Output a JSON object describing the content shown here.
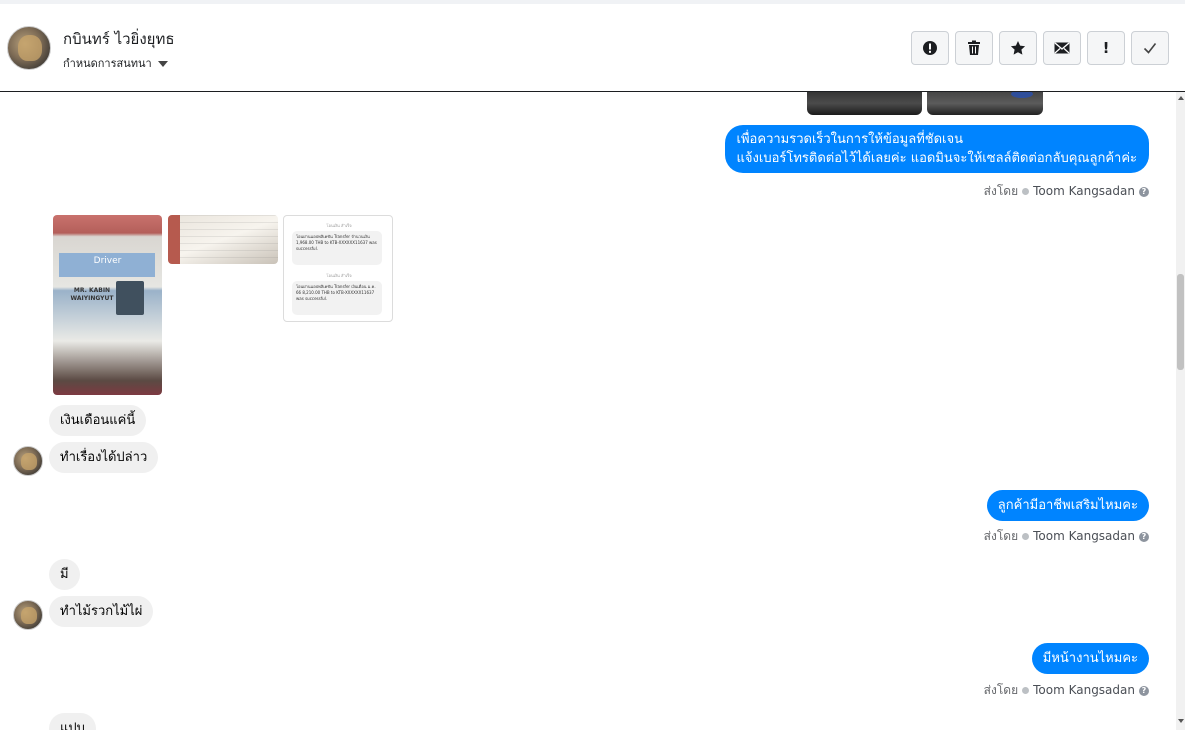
{
  "header": {
    "name": "กบินทร์ ไวยิ่งยุทธ",
    "assign_label": "กำหนดการสนทนา",
    "actions": [
      {
        "icon": "alert-circle-icon",
        "glyph": "!"
      },
      {
        "icon": "trash-icon",
        "glyph": "🗑"
      },
      {
        "icon": "star-icon",
        "glyph": "★"
      },
      {
        "icon": "envelope-icon",
        "glyph": "✉"
      },
      {
        "icon": "exclamation-icon",
        "glyph": "!"
      },
      {
        "icon": "check-icon",
        "glyph": "✓"
      }
    ]
  },
  "messages": {
    "out1_line1": "เพื่อความรวดเร็วในการให้ข้อมูลที่ชัดเจน",
    "out1_line2": "แจ้งเบอร์โทรติดต่อไว้ได้เลยค่ะ แอดมินจะให้เซลล์ติดต่อกลับคุณลูกค้าค่ะ",
    "sent_by": "ส่งโดย",
    "agent": "Toom Kangsadan",
    "help": "?",
    "in1": "เงินเดือนแค่นี้",
    "in2": "ทำเรื่องได้ปล่าว",
    "out2": "ลูกค้ามีอาชีพเสริมไหมคะ",
    "in3": "มี",
    "in4": "ทำไม้รวกไม้ไผ่",
    "out3": "มีหน้างานไหมคะ",
    "in5": "แปบ"
  },
  "attachments": {
    "card_driver": "Driver",
    "card_name_line1": "MR. KABIN",
    "card_name_line2": "WAIYINGYUT",
    "slip1_header": "โอนเงิน สำเร็จ",
    "slip1_text": "โอนผ่านแอปพลิเคชัน Transfer จำนวนเงิน 1,968.00 THB to KTB-XXXXXX11637 was successful.",
    "slip2_header": "โอนเงิน สำเร็จ",
    "slip2_text": "โอนผ่านแอปพลิเคชัน Transfer เงินเดือน ม.ค. 66 8,210.00 THB to KTB-XXXXXX11637 was successful."
  },
  "colors": {
    "outgoing_bubble": "#0084ff",
    "incoming_bubble": "#f0f0f0"
  }
}
